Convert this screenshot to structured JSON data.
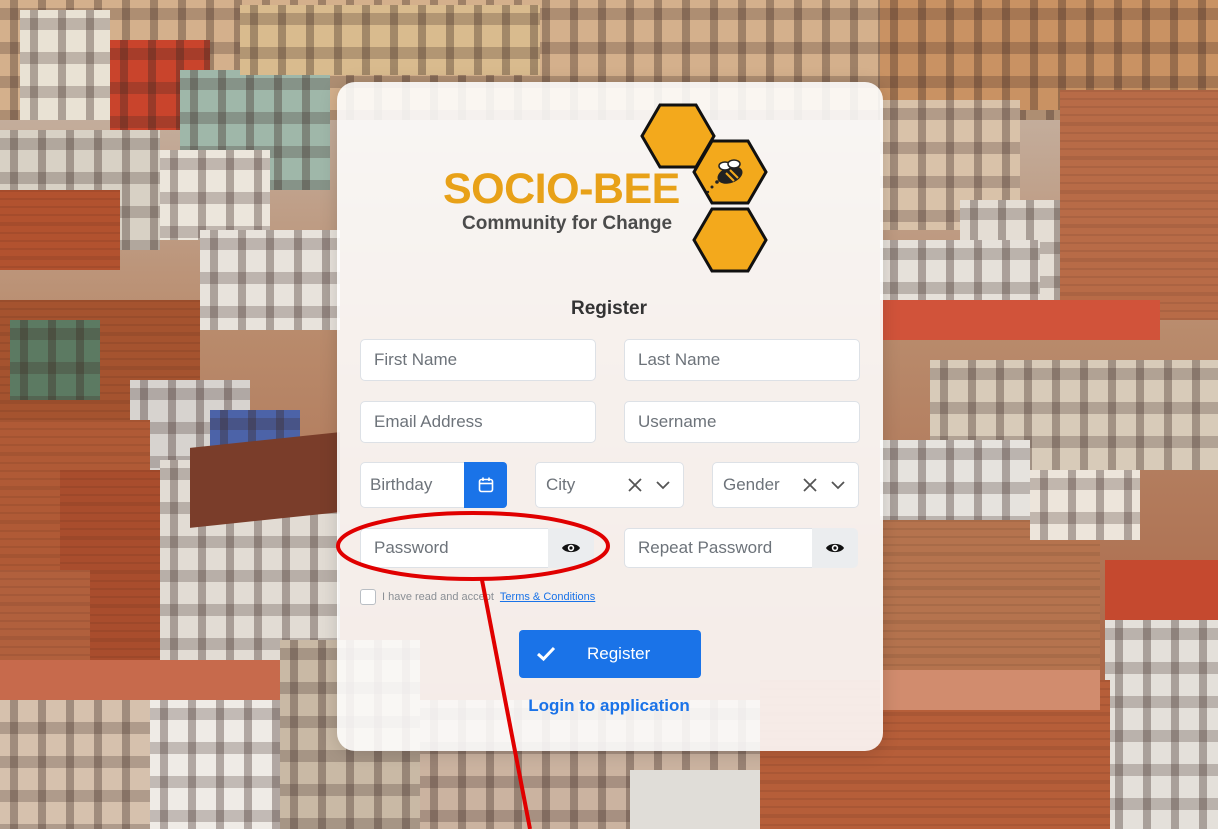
{
  "brand": {
    "title": "SOCIO-BEE",
    "subtitle": "Community for Change"
  },
  "form": {
    "heading": "Register",
    "first_name_placeholder": "First Name",
    "last_name_placeholder": "Last Name",
    "email_placeholder": "Email Address",
    "username_placeholder": "Username",
    "birthday_placeholder": "Birthday",
    "city_placeholder": "City",
    "gender_placeholder": "Gender",
    "password_placeholder": "Password",
    "repeat_password_placeholder": "Repeat Password",
    "terms_text": "I have read and accept",
    "terms_link": "Terms & Conditions",
    "register_button": "Register",
    "login_link": "Login to application"
  },
  "icons": {
    "calendar": "calendar-icon",
    "clear": "close-icon",
    "dropdown": "chevron-down-icon",
    "eye": "eye-icon",
    "check": "check-icon"
  },
  "colors": {
    "primary": "#1a73e8",
    "brand": "#e8a118",
    "annotation": "#e00000"
  }
}
